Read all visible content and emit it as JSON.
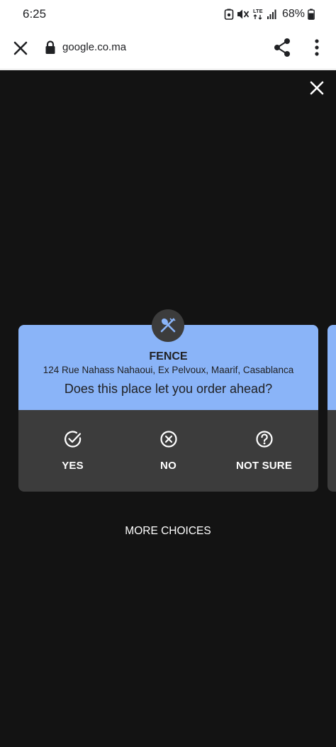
{
  "status_bar": {
    "time": "6:25",
    "lte_label": "LTE",
    "battery": "68%"
  },
  "browser": {
    "url": "google.co.ma"
  },
  "place": {
    "name": "FENCE",
    "address": "124 Rue Nahass Nahaoui, Ex Pelvoux, Maarif, Casablanca",
    "question": "Does this place let you order ahead?",
    "category_icon": "restaurant-icon"
  },
  "choices": {
    "yes": "YES",
    "no": "NO",
    "not_sure": "NOT SURE"
  },
  "more_choices": "MORE CHOICES",
  "colors": {
    "card_header": "#8ab4f8",
    "card_body": "#3c3c3c",
    "overlay": "#131313"
  }
}
